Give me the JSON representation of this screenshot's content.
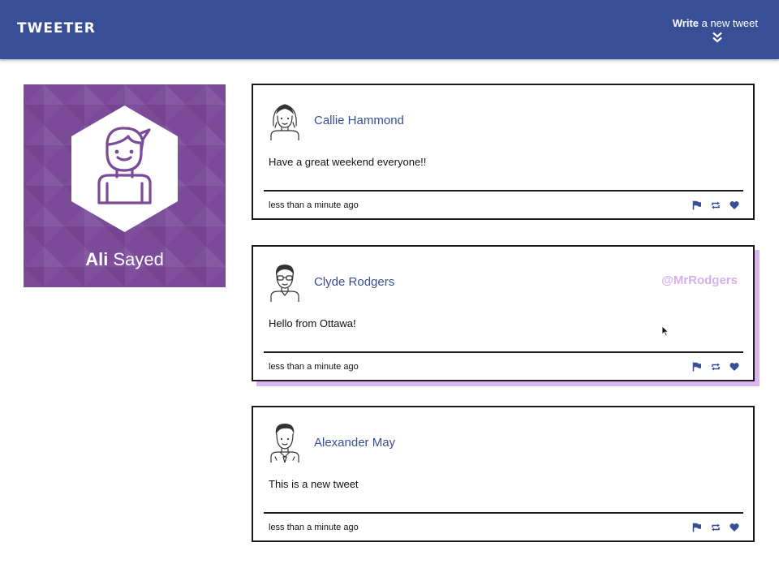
{
  "header": {
    "brand": "TWEETER",
    "compose_bold": "Write",
    "compose_rest": " a new tweet",
    "chevron_icon": "double-chevron-down-icon"
  },
  "profile": {
    "first_name": "Ali",
    "last_name": " Sayed",
    "background_color": "#7b4a99"
  },
  "tweets": [
    {
      "author": "Callie Hammond",
      "handle": "",
      "content": "Have a great weekend everyone!!",
      "time": "less than a minute ago",
      "avatar_icon": "woman-avatar-icon",
      "hovered": false
    },
    {
      "author": "Clyde Rodgers",
      "handle": "@MrRodgers",
      "content": "Hello from Ottawa!",
      "time": "less than a minute ago",
      "avatar_icon": "man-glasses-avatar-icon",
      "hovered": true
    },
    {
      "author": "Alexander May",
      "handle": "",
      "content": "This is a new tweet",
      "time": "less than a minute ago",
      "avatar_icon": "man-tie-avatar-icon",
      "hovered": false
    }
  ],
  "actions": {
    "icons": [
      "flag-icon",
      "retweet-icon",
      "heart-icon"
    ],
    "color": "#384e96"
  },
  "colors": {
    "navbar": "#384e96",
    "hover_shadow": "#d9b7ec",
    "handle": "#d4b0ec"
  }
}
